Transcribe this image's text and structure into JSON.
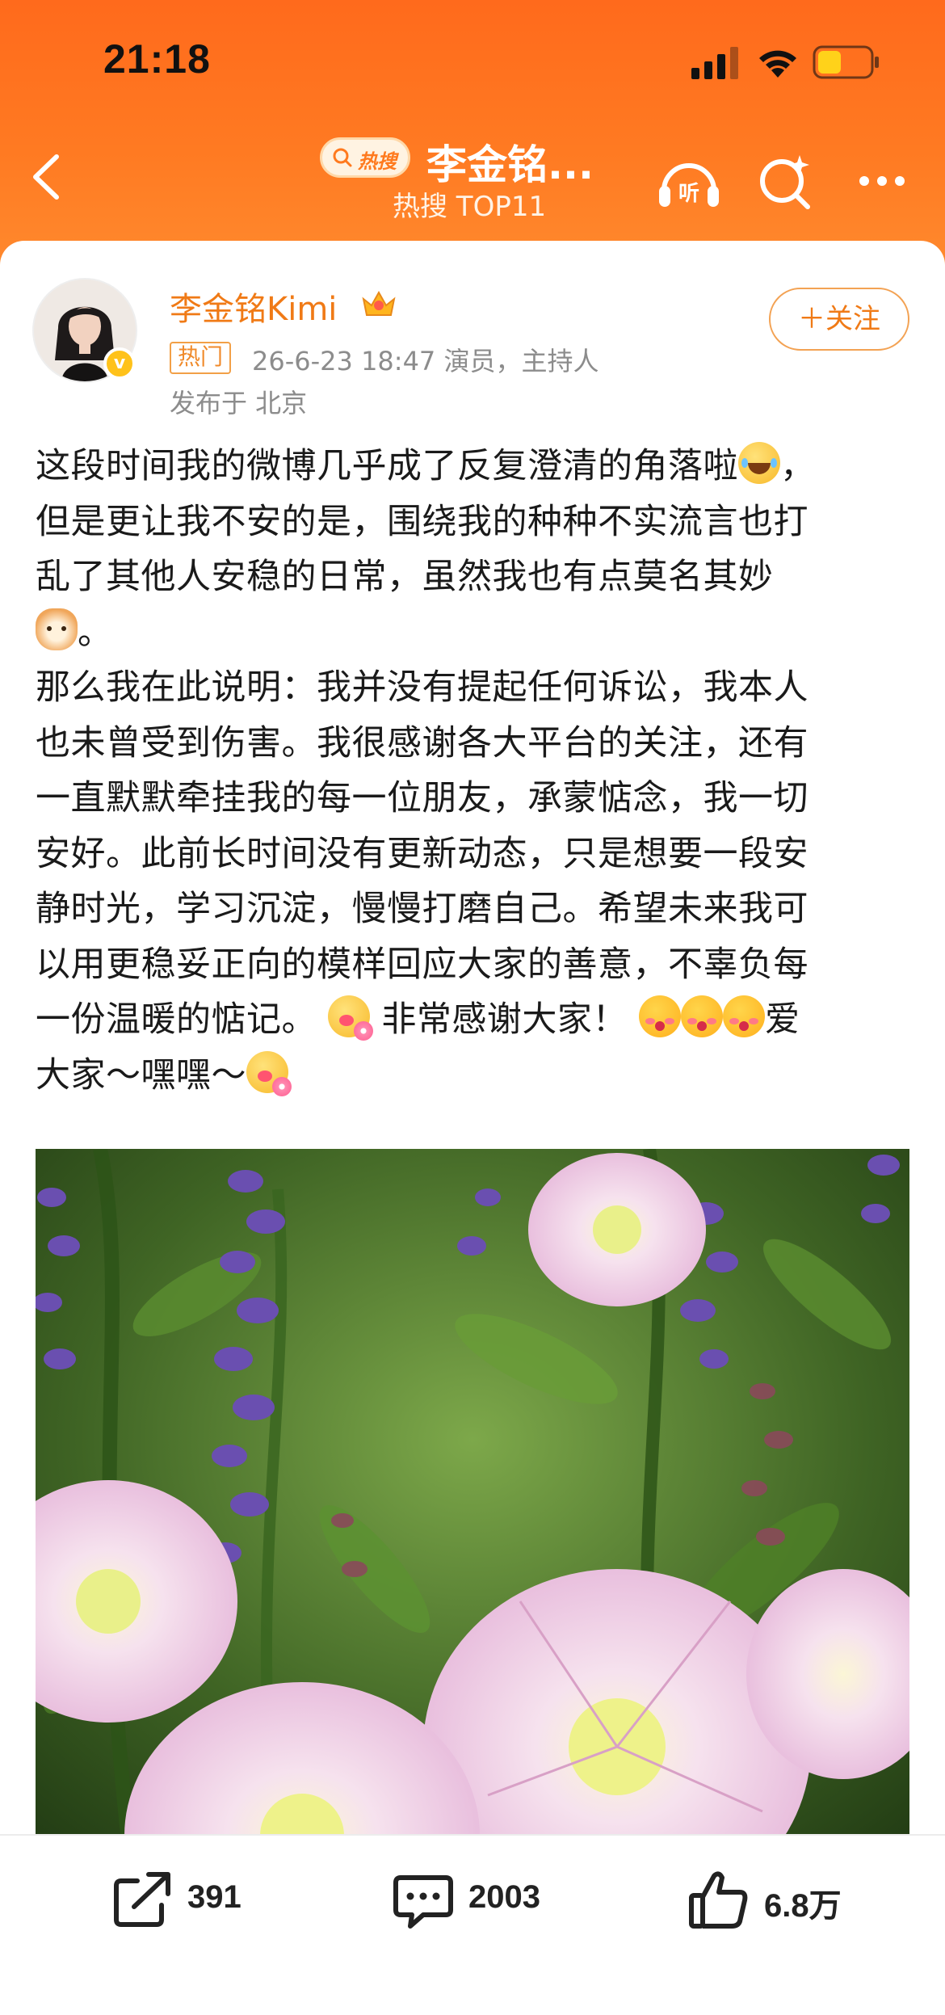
{
  "status_bar": {
    "time": "21:18"
  },
  "nav": {
    "hot_badge": "热搜",
    "title": "李金铭...",
    "subtitle": "热搜 TOP11"
  },
  "post": {
    "username": "李金铭Kimi",
    "hot_tag": "热门",
    "meta": "26-6-23 18:47  演员，主持人",
    "location": "发布于 北京",
    "follow_label": "＋关注",
    "lines": [
      "这段时间我的微博几乎成了反复澄清的角落啦",
      "，",
      "但是更让我不安的是，围绕我的种种不实流言也打",
      "乱了其他人安稳的日常，虽然我也有点莫名其妙",
      "。",
      "那么我在此说明：我并没有提起任何诉讼，我本人",
      "也未曾受到伤害。我很感谢各大平台的关注，还有",
      "一直默默牵挂我的每一位朋友，承蒙惦念，我一切",
      "安好。此前长时间没有更新动态，只是想要一段安",
      "静时光，学习沉淀，慢慢打磨自己。希望未来我可",
      "以用更稳妥正向的模样回应大家的善意，不辜负每",
      "一份温暖的惦记。",
      " 非常感谢大家！",
      "爱",
      "大家～嘿嘿～"
    ]
  },
  "actions": {
    "repost_count": "391",
    "comment_count": "2003",
    "like_count": "6.8万"
  },
  "colors": {
    "header_orange": "#ff7a22",
    "username_orange": "#f07a16",
    "follow_border": "#f3a253"
  }
}
